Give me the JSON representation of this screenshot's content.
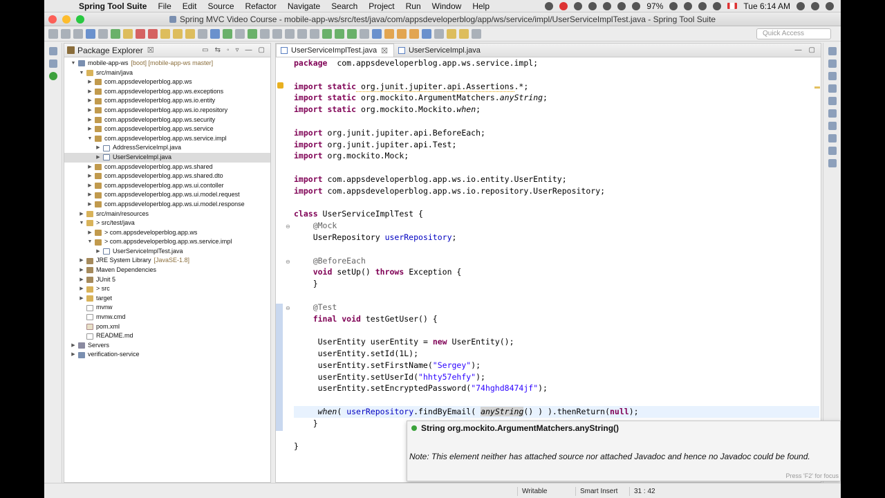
{
  "menubar": {
    "app": "Spring Tool Suite",
    "items": [
      "File",
      "Edit",
      "Source",
      "Refactor",
      "Navigate",
      "Search",
      "Project",
      "Run",
      "Window",
      "Help"
    ],
    "battery": "97%",
    "clock": "Tue 6:14 AM"
  },
  "window": {
    "title": "Spring MVC Video Course - mobile-app-ws/src/test/java/com/appsdeveloperblog/app/ws/service/impl/UserServiceImplTest.java - Spring Tool Suite"
  },
  "toolbar": {
    "quick_access_placeholder": "Quick Access"
  },
  "package_explorer": {
    "title": "Package Explorer",
    "close_glyph": "☒",
    "tree": [
      {
        "indent": 0,
        "arrow": "▼",
        "icon": "project",
        "label": "mobile-app-ws",
        "deco": "[boot] [mobile-app-ws master]"
      },
      {
        "indent": 1,
        "arrow": "▼",
        "icon": "folder",
        "label": "src/main/java",
        "deco": ""
      },
      {
        "indent": 2,
        "arrow": "▶",
        "icon": "package",
        "label": "com.appsdeveloperblog.app.ws",
        "deco": ""
      },
      {
        "indent": 2,
        "arrow": "▶",
        "icon": "package",
        "label": "com.appsdeveloperblog.app.ws.exceptions",
        "deco": ""
      },
      {
        "indent": 2,
        "arrow": "▶",
        "icon": "package",
        "label": "com.appsdeveloperblog.app.ws.io.entity",
        "deco": ""
      },
      {
        "indent": 2,
        "arrow": "▶",
        "icon": "package",
        "label": "com.appsdeveloperblog.app.ws.io.repository",
        "deco": ""
      },
      {
        "indent": 2,
        "arrow": "▶",
        "icon": "package",
        "label": "com.appsdeveloperblog.app.ws.security",
        "deco": ""
      },
      {
        "indent": 2,
        "arrow": "▶",
        "icon": "package",
        "label": "com.appsdeveloperblog.app.ws.service",
        "deco": ""
      },
      {
        "indent": 2,
        "arrow": "▼",
        "icon": "package",
        "label": "com.appsdeveloperblog.app.ws.service.impl",
        "deco": ""
      },
      {
        "indent": 3,
        "arrow": "▶",
        "icon": "java",
        "label": "AddressServiceImpl.java",
        "deco": ""
      },
      {
        "indent": 3,
        "arrow": "▶",
        "icon": "java",
        "label": "UserServiceImpl.java",
        "deco": "",
        "selected": true
      },
      {
        "indent": 2,
        "arrow": "▶",
        "icon": "package",
        "label": "com.appsdeveloperblog.app.ws.shared",
        "deco": ""
      },
      {
        "indent": 2,
        "arrow": "▶",
        "icon": "package",
        "label": "com.appsdeveloperblog.app.ws.shared.dto",
        "deco": ""
      },
      {
        "indent": 2,
        "arrow": "▶",
        "icon": "package",
        "label": "com.appsdeveloperblog.app.ws.ui.contoller",
        "deco": ""
      },
      {
        "indent": 2,
        "arrow": "▶",
        "icon": "package",
        "label": "com.appsdeveloperblog.app.ws.ui.model.request",
        "deco": ""
      },
      {
        "indent": 2,
        "arrow": "▶",
        "icon": "package",
        "label": "com.appsdeveloperblog.app.ws.ui.model.response",
        "deco": ""
      },
      {
        "indent": 1,
        "arrow": "▶",
        "icon": "folder",
        "label": "src/main/resources",
        "deco": ""
      },
      {
        "indent": 1,
        "arrow": "▼",
        "icon": "folder",
        "label": "> src/test/java",
        "deco": ""
      },
      {
        "indent": 2,
        "arrow": "▶",
        "icon": "package",
        "label": "> com.appsdeveloperblog.app.ws",
        "deco": ""
      },
      {
        "indent": 2,
        "arrow": "▼",
        "icon": "package",
        "label": "> com.appsdeveloperblog.app.ws.service.impl",
        "deco": ""
      },
      {
        "indent": 3,
        "arrow": "▶",
        "icon": "java",
        "label": "UserServiceImplTest.java",
        "deco": ""
      },
      {
        "indent": 1,
        "arrow": "▶",
        "icon": "lib",
        "label": "JRE System Library",
        "deco": "[JavaSE-1.8]"
      },
      {
        "indent": 1,
        "arrow": "▶",
        "icon": "lib",
        "label": "Maven Dependencies",
        "deco": ""
      },
      {
        "indent": 1,
        "arrow": "▶",
        "icon": "lib",
        "label": "JUnit 5",
        "deco": ""
      },
      {
        "indent": 1,
        "arrow": "▶",
        "icon": "folder",
        "label": "> src",
        "deco": ""
      },
      {
        "indent": 1,
        "arrow": "▶",
        "icon": "folder",
        "label": "target",
        "deco": ""
      },
      {
        "indent": 1,
        "arrow": "",
        "icon": "file",
        "label": "mvnw",
        "deco": ""
      },
      {
        "indent": 1,
        "arrow": "",
        "icon": "file",
        "label": "mvnw.cmd",
        "deco": ""
      },
      {
        "indent": 1,
        "arrow": "",
        "icon": "xml",
        "label": "pom.xml",
        "deco": ""
      },
      {
        "indent": 1,
        "arrow": "",
        "icon": "file",
        "label": "README.md",
        "deco": ""
      },
      {
        "indent": 0,
        "arrow": "▶",
        "icon": "server",
        "label": "Servers",
        "deco": ""
      },
      {
        "indent": 0,
        "arrow": "▶",
        "icon": "project",
        "label": "verification-service",
        "deco": ""
      }
    ]
  },
  "editor": {
    "tabs": [
      {
        "label": "UserServiceImplTest.java",
        "active": true
      },
      {
        "label": "UserServiceImpl.java",
        "active": false
      }
    ],
    "lines": [
      [
        [
          "kw",
          "package"
        ],
        [
          "",
          "  com.appsdeveloperblog.app.ws.service.impl;"
        ]
      ],
      [],
      [
        [
          "kw",
          "import static"
        ],
        [
          "ul",
          " org.junit.jupiter.api.Assertions"
        ],
        [
          "",
          ".*;"
        ]
      ],
      [
        [
          "kw",
          "import static"
        ],
        [
          "",
          " org.mockito.ArgumentMatchers."
        ],
        [
          "it",
          "anyString"
        ],
        [
          "",
          ";"
        ]
      ],
      [
        [
          "kw",
          "import static"
        ],
        [
          "",
          " org.mockito.Mockito."
        ],
        [
          "it",
          "when"
        ],
        [
          "",
          ";"
        ]
      ],
      [],
      [
        [
          "kw",
          "import"
        ],
        [
          "",
          " org.junit.jupiter.api.BeforeEach;"
        ]
      ],
      [
        [
          "kw",
          "import"
        ],
        [
          "",
          " org.junit.jupiter.api.Test;"
        ]
      ],
      [
        [
          "kw",
          "import"
        ],
        [
          "",
          " org.mockito.Mock;"
        ]
      ],
      [],
      [
        [
          "kw",
          "import"
        ],
        [
          "",
          " com.appsdeveloperblog.app.ws.io.entity.UserEntity;"
        ]
      ],
      [
        [
          "kw",
          "import"
        ],
        [
          "",
          " com.appsdeveloperblog.app.ws.io.repository.UserRepository;"
        ]
      ],
      [],
      [
        [
          "kw",
          "class"
        ],
        [
          "",
          " UserServiceImplTest {"
        ]
      ],
      [
        [
          "",
          "    "
        ],
        [
          "ann",
          "@Mock"
        ]
      ],
      [
        [
          "",
          "    UserRepository "
        ],
        [
          "fld",
          "userRepository"
        ],
        [
          "",
          ";"
        ]
      ],
      [],
      [
        [
          "",
          "    "
        ],
        [
          "ann",
          "@BeforeEach"
        ]
      ],
      [
        [
          "",
          "    "
        ],
        [
          "kw",
          "void"
        ],
        [
          "",
          " setUp() "
        ],
        [
          "kw",
          "throws"
        ],
        [
          "",
          " Exception {"
        ]
      ],
      [
        [
          "",
          "    }"
        ]
      ],
      [],
      [
        [
          "",
          "    "
        ],
        [
          "ann",
          "@Test"
        ]
      ],
      [
        [
          "",
          "    "
        ],
        [
          "kw",
          "final void"
        ],
        [
          "",
          " testGetUser() {"
        ]
      ],
      [],
      [
        [
          "",
          "     UserEntity "
        ],
        [
          "",
          "userEntity"
        ],
        [
          "",
          " = "
        ],
        [
          "kw",
          "new"
        ],
        [
          "",
          " UserEntity();"
        ]
      ],
      [
        [
          "",
          "     userEntity.setId(1L);"
        ]
      ],
      [
        [
          "",
          "     userEntity.setFirstName("
        ],
        [
          "str",
          "\"Sergey\""
        ],
        [
          "",
          ");"
        ]
      ],
      [
        [
          "",
          "     userEntity.setUserId("
        ],
        [
          "str",
          "\"hhty57ehfy\""
        ],
        [
          "",
          ");"
        ]
      ],
      [
        [
          "",
          "     userEntity.setEncryptedPassword("
        ],
        [
          "str",
          "\"74hghd8474jf\""
        ],
        [
          "",
          ");"
        ]
      ],
      [],
      [
        [
          "",
          "     "
        ],
        [
          "it",
          "when"
        ],
        [
          "",
          "( "
        ],
        [
          "fld",
          "userRepository"
        ],
        [
          "",
          ".findByEmail( "
        ],
        [
          "it hl",
          "anyString"
        ],
        [
          "",
          "() ) ).thenReturn("
        ],
        [
          "kw",
          "null"
        ],
        [
          "",
          ");"
        ]
      ],
      [
        [
          "",
          "    }"
        ]
      ],
      [],
      [
        [
          "",
          "}"
        ]
      ]
    ],
    "current_line": 30
  },
  "hover": {
    "signature": "String org.mockito.ArgumentMatchers.anyString()",
    "note_label": "Note:",
    "note": "This element neither has attached source nor attached Javadoc and hence no Javadoc could be found.",
    "footer": "Press 'F2' for focus"
  },
  "statusbar": {
    "writable": "Writable",
    "insert_mode": "Smart Insert",
    "position": "31 : 42"
  }
}
